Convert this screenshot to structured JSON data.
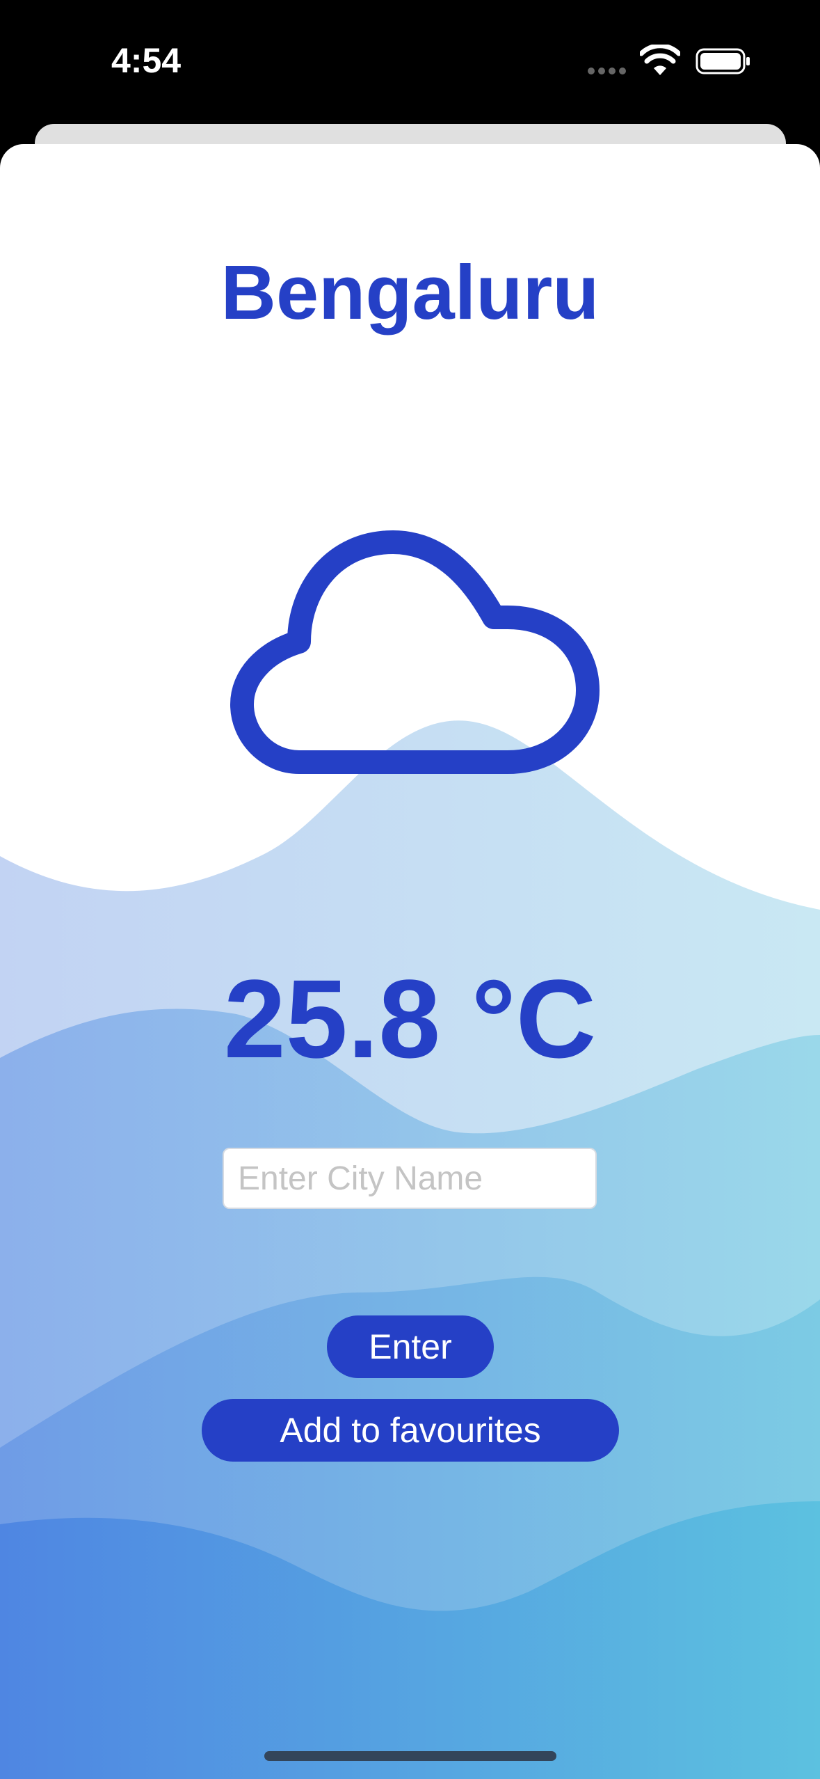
{
  "status_bar": {
    "time": "4:54",
    "icons": [
      "cellular-dots-icon",
      "wifi-icon",
      "battery-icon"
    ]
  },
  "weather": {
    "city": "Bengaluru",
    "condition_icon": "cloud-icon",
    "temperature": "25.8 °C"
  },
  "search": {
    "value": "",
    "placeholder": "Enter City Name"
  },
  "actions": {
    "enter_label": "Enter",
    "favourite_label": "Add to favourites"
  },
  "colors": {
    "accent": "#2540c6",
    "wave_light": "#c8dff1",
    "wave_mid": "#8db8e8",
    "wave_dark": "#5d95df"
  }
}
